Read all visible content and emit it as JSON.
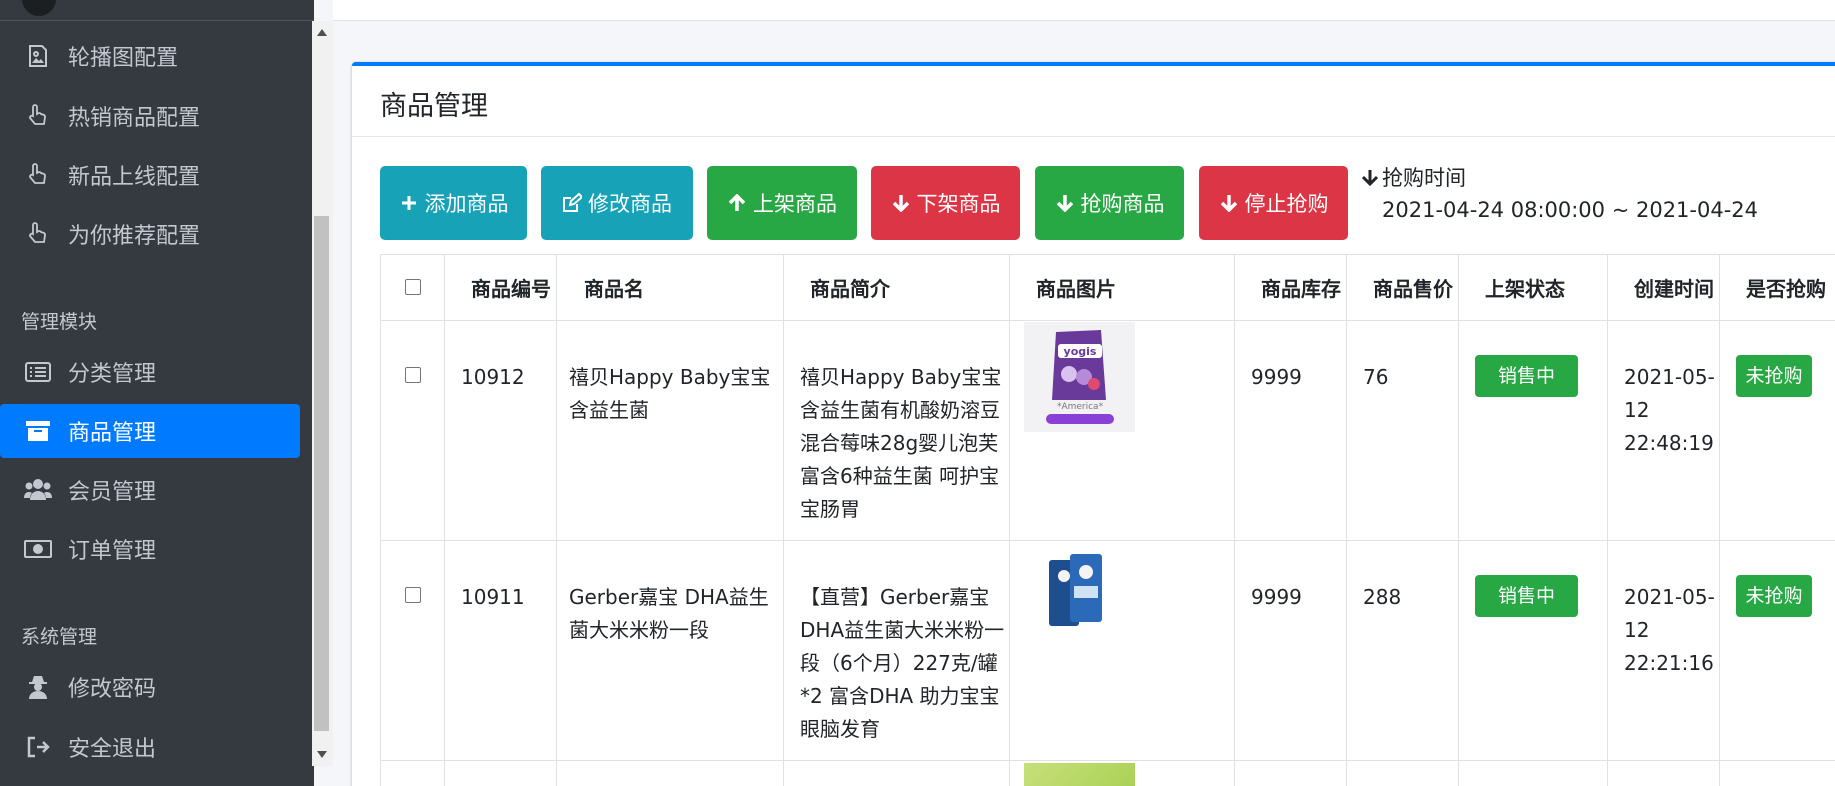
{
  "sidebar": {
    "items_top": [
      {
        "label": "轮播图配置",
        "icon": "image-icon"
      },
      {
        "label": "热销商品配置",
        "icon": "hand-pointer-icon"
      },
      {
        "label": "新品上线配置",
        "icon": "hand-pointer-icon"
      },
      {
        "label": "为你推荐配置",
        "icon": "hand-pointer-icon"
      }
    ],
    "section_manage": "管理模块",
    "items_manage": [
      {
        "label": "分类管理",
        "icon": "list-icon"
      },
      {
        "label": "商品管理",
        "icon": "archive-box-icon"
      },
      {
        "label": "会员管理",
        "icon": "users-icon"
      },
      {
        "label": "订单管理",
        "icon": "money-bill-icon"
      }
    ],
    "section_system": "系统管理",
    "items_system": [
      {
        "label": "修改密码",
        "icon": "user-secret-icon"
      },
      {
        "label": "安全退出",
        "icon": "sign-out-icon"
      }
    ]
  },
  "card": {
    "title": "商品管理",
    "buttons": {
      "add": "添加商品",
      "edit": "修改商品",
      "list_up": "上架商品",
      "list_down": "下架商品",
      "flash": "抢购商品",
      "stop_flash": "停止抢购"
    },
    "flash_label": "抢购时间",
    "flash_range": "2021-04-24 08:00:00 ~ 2021-04-24"
  },
  "table": {
    "headers": [
      "商品编号",
      "商品名",
      "商品简介",
      "商品图片",
      "商品库存",
      "商品售价",
      "上架状态",
      "创建时间",
      "是否抢购"
    ],
    "rows": [
      {
        "id": "10912",
        "name": "禧贝Happy Baby宝宝含益生菌",
        "intro": "禧贝Happy Baby宝宝含益生菌有机酸奶溶豆混合莓味28g婴儿泡芙 富含6种益生菌 呵护宝宝肠胃",
        "img_text": "yogis",
        "img_sub": "*America*",
        "stock": "9999",
        "price": "76",
        "status": "销售中",
        "created": "2021-05-12 22:48:19",
        "flash": "未抢购"
      },
      {
        "id": "10911",
        "name": "Gerber嘉宝 DHA益生菌大米米粉一段",
        "intro": "【直营】Gerber嘉宝DHA益生菌大米米粉一段（6个月）227克/罐*2 富含DHA 助力宝宝眼脑发育",
        "stock": "9999",
        "price": "288",
        "status": "销售中",
        "created": "2021-05-12 22:21:16",
        "flash": "未抢购"
      }
    ]
  },
  "colors": {
    "sidebar_bg": "#343a40",
    "active": "#007bff",
    "info": "#17a2b8",
    "success": "#28a745",
    "danger": "#dc3545"
  }
}
